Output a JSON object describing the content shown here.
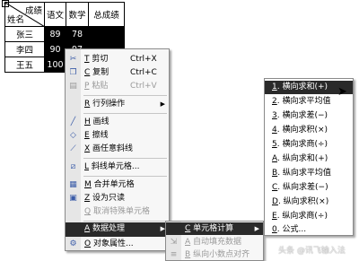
{
  "table": {
    "header": {
      "diag_top": "成绩",
      "diag_bottom": "姓名",
      "col1": "语文",
      "col2": "数学",
      "col3": "总成绩"
    },
    "rows": [
      {
        "name": "张三",
        "chinese": "89",
        "math": "78",
        "total": ""
      },
      {
        "name": "李四",
        "chinese": "90",
        "math": "97",
        "total": ""
      },
      {
        "name": "王五",
        "chinese": "100",
        "math": "",
        "total": ""
      }
    ]
  },
  "context_menu": {
    "items": [
      {
        "key": "T",
        "label": "剪切",
        "shortcut": "Ctrl+X",
        "icon": "scissors-icon",
        "disabled": false
      },
      {
        "key": "C",
        "label": "复制",
        "shortcut": "Ctrl+C",
        "icon": "copy-icon",
        "disabled": false
      },
      {
        "key": "P",
        "label": "粘贴",
        "shortcut": "Ctrl+V",
        "icon": "paste-icon",
        "disabled": true
      },
      {
        "key": "R",
        "label": "行列操作",
        "shortcut": "",
        "icon": "",
        "disabled": false,
        "submenu": true
      },
      {
        "key": "H",
        "label": "画线",
        "shortcut": "",
        "icon": "pen-icon",
        "disabled": false
      },
      {
        "key": "E",
        "label": "擦线",
        "shortcut": "",
        "icon": "eraser-icon",
        "disabled": false
      },
      {
        "key": "X",
        "label": "画任意斜线",
        "shortcut": "",
        "icon": "diagonal-pen-icon",
        "disabled": false
      },
      {
        "key": "L",
        "label": "斜线单元格...",
        "shortcut": "",
        "icon": "diagonal-cell-icon",
        "disabled": false
      },
      {
        "key": "M",
        "label": "合并单元格",
        "shortcut": "",
        "icon": "merge-cells-icon",
        "disabled": false
      },
      {
        "key": "Z",
        "label": "设为只读",
        "shortcut": "",
        "icon": "lock-icon",
        "disabled": false
      },
      {
        "key": "Q",
        "label": "取消特殊单元格",
        "shortcut": "",
        "icon": "",
        "disabled": true
      },
      {
        "key": "A",
        "label": "数据处理",
        "shortcut": "",
        "icon": "",
        "disabled": false,
        "submenu": true
      },
      {
        "key": "O",
        "label": "对象属性...",
        "shortcut": "",
        "icon": "properties-icon",
        "disabled": false
      }
    ]
  },
  "data_submenu": {
    "items": [
      {
        "key": "C",
        "label": "单元格计算",
        "disabled": false,
        "submenu": true
      },
      {
        "key": "A",
        "label": "自动填充数据",
        "disabled": true
      },
      {
        "key": "B",
        "label": "纵向小数点对齐",
        "disabled": true
      }
    ]
  },
  "calc_submenu": {
    "items": [
      {
        "key": "1",
        "label": "横向求和(+)"
      },
      {
        "key": "2",
        "label": "横向求平均值"
      },
      {
        "key": "3",
        "label": "横向求差(−)"
      },
      {
        "key": "4",
        "label": "横向求积(×)"
      },
      {
        "key": "5",
        "label": "横向求商(÷)"
      },
      {
        "key": "A",
        "label": "纵向求和(+)"
      },
      {
        "key": "B",
        "label": "纵向求平均值"
      },
      {
        "key": "C",
        "label": "纵向求差(−)"
      },
      {
        "key": "D",
        "label": "纵向求积(×)"
      },
      {
        "key": "E",
        "label": "纵向求商(÷)"
      },
      {
        "key": "0",
        "label": "公式..."
      }
    ]
  },
  "watermark": "头条 @讯飞输入法"
}
